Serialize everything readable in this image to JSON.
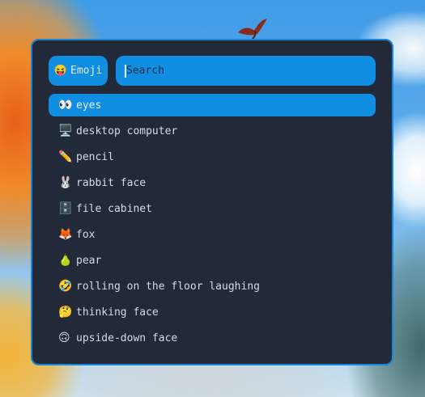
{
  "launcher": {
    "mode_button": {
      "icon": "😝",
      "label": "Emoji"
    },
    "search": {
      "placeholder": "Search",
      "value": ""
    },
    "results": [
      {
        "emoji": "👀",
        "label": "eyes",
        "selected": true
      },
      {
        "emoji": "🖥️",
        "label": "desktop computer",
        "selected": false
      },
      {
        "emoji": "✏️",
        "label": "pencil",
        "selected": false
      },
      {
        "emoji": "🐰",
        "label": "rabbit face",
        "selected": false
      },
      {
        "emoji": "🗄️",
        "label": "file cabinet",
        "selected": false
      },
      {
        "emoji": "🦊",
        "label": "fox",
        "selected": false
      },
      {
        "emoji": "🍐",
        "label": "pear",
        "selected": false
      },
      {
        "emoji": "🤣",
        "label": "rolling on the floor laughing",
        "selected": false
      },
      {
        "emoji": "🤔",
        "label": "thinking face",
        "selected": false
      },
      {
        "emoji": "🙃",
        "label": "upside-down face",
        "selected": false
      }
    ]
  },
  "colors": {
    "accent": "#0f8ee2",
    "panel_bg": "#222a3a",
    "border": "#1687d9",
    "text": "#d4dae3"
  }
}
